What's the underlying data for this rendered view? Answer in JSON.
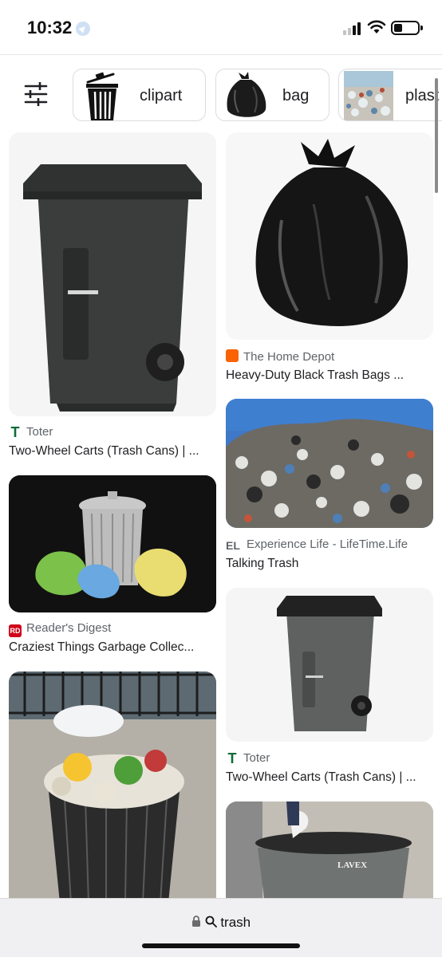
{
  "status": {
    "time": "10:32"
  },
  "chips": [
    {
      "label": "clipart",
      "icon": "trash-can-clipart-icon"
    },
    {
      "label": "bag",
      "icon": "trash-bag-icon"
    },
    {
      "label": "plast",
      "icon": "plastic-waste-thumb"
    }
  ],
  "results": [
    {
      "source": "Toter",
      "caption": "Two-Wheel Carts (Trash Cans) | ...",
      "favicon": "T",
      "favicon_color": "#0f6b3a"
    },
    {
      "source": "The Home Depot",
      "caption": "Heavy-Duty Black Trash Bags ...",
      "favicon": "",
      "favicon_color": "#f96302"
    },
    {
      "source": "Experience Life - LifeTime.Life",
      "caption": "Talking Trash",
      "favicon": "EL",
      "favicon_color": "#ffffff"
    },
    {
      "source": "Reader's Digest",
      "caption": "Craziest Things Garbage Collec...",
      "favicon": "RD",
      "favicon_color": "#d0021b"
    },
    {
      "source": "Toter",
      "caption": "Two-Wheel Carts (Trash Cans) | ...",
      "favicon": "T",
      "favicon_color": "#0f6b3a"
    }
  ],
  "bottom": {
    "url": "trash"
  },
  "colors": {
    "accent_toter": "#0f6b3a",
    "accent_homedepot": "#f96302",
    "accent_rd": "#d0021b"
  }
}
